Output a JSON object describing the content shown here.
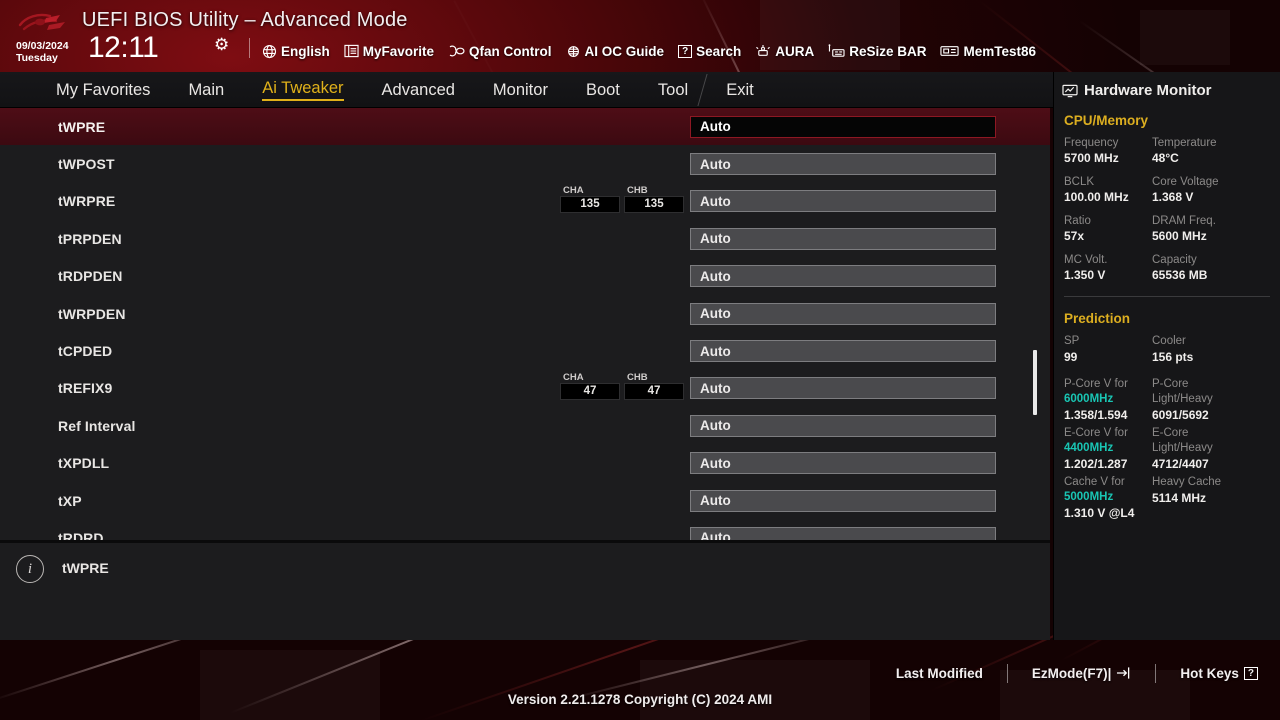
{
  "header": {
    "logo": "rog-logo",
    "title": "UEFI BIOS Utility – Advanced Mode",
    "date": "09/03/2024",
    "weekday": "Tuesday",
    "time": "12:11",
    "gear_icon": "gear-icon",
    "items": [
      {
        "icon": "globe-icon",
        "label": "English"
      },
      {
        "icon": "list-icon",
        "label": "MyFavorite"
      },
      {
        "icon": "fan-icon",
        "label": "Qfan Control"
      },
      {
        "icon": "chip-icon",
        "label": "AI OC Guide"
      },
      {
        "icon": "question-box-icon",
        "label": "Search"
      },
      {
        "icon": "aura-icon",
        "label": "AURA"
      },
      {
        "icon": "resize-bar-icon",
        "label": "ReSize BAR"
      },
      {
        "icon": "memtest-icon",
        "label": "MemTest86"
      }
    ]
  },
  "nav": {
    "tabs": [
      {
        "label": "My Favorites",
        "active": false
      },
      {
        "label": "Main",
        "active": false
      },
      {
        "label": "Ai Tweaker",
        "active": true
      },
      {
        "label": "Advanced",
        "active": false
      },
      {
        "label": "Monitor",
        "active": false
      },
      {
        "label": "Boot",
        "active": false
      },
      {
        "label": "Tool",
        "active": false
      },
      {
        "label": "Exit",
        "active": false
      }
    ],
    "active_color": "#e0b11a"
  },
  "main": {
    "rows": [
      {
        "label": "tWPRE",
        "value": "Auto",
        "selected": true,
        "channels": null
      },
      {
        "label": "tWPOST",
        "value": "Auto",
        "selected": false,
        "channels": null
      },
      {
        "label": "tWRPRE",
        "value": "Auto",
        "selected": false,
        "channels": [
          {
            "name": "CHA",
            "value": "135"
          },
          {
            "name": "CHB",
            "value": "135"
          }
        ]
      },
      {
        "label": "tPRPDEN",
        "value": "Auto",
        "selected": false,
        "channels": null
      },
      {
        "label": "tRDPDEN",
        "value": "Auto",
        "selected": false,
        "channels": null
      },
      {
        "label": "tWRPDEN",
        "value": "Auto",
        "selected": false,
        "channels": null
      },
      {
        "label": "tCPDED",
        "value": "Auto",
        "selected": false,
        "channels": null
      },
      {
        "label": "tREFIX9",
        "value": "Auto",
        "selected": false,
        "channels": [
          {
            "name": "CHA",
            "value": "47"
          },
          {
            "name": "CHB",
            "value": "47"
          }
        ]
      },
      {
        "label": "Ref Interval",
        "value": "Auto",
        "selected": false,
        "channels": null
      },
      {
        "label": "tXPDLL",
        "value": "Auto",
        "selected": false,
        "channels": null
      },
      {
        "label": "tXP",
        "value": "Auto",
        "selected": false,
        "channels": null
      },
      {
        "label": "tRDRD",
        "value": "Auto",
        "selected": false,
        "channels": null
      }
    ],
    "selected_row_color": "#4e0d16",
    "scrollbar": {
      "top_pct": 56,
      "height_pct": 15
    }
  },
  "info_panel": {
    "icon": "info-icon",
    "text": "tWPRE"
  },
  "hardware_monitor": {
    "icon": "monitor-icon",
    "title": "Hardware Monitor",
    "sections": [
      {
        "name": "CPU/Memory",
        "color": "#dcae20",
        "entries": [
          {
            "key": "Frequency",
            "value": "5700 MHz"
          },
          {
            "key": "Temperature",
            "value": "48°C"
          },
          {
            "key": "BCLK",
            "value": "100.00 MHz"
          },
          {
            "key": "Core Voltage",
            "value": "1.368 V"
          },
          {
            "key": "Ratio",
            "value": "57x"
          },
          {
            "key": "DRAM Freq.",
            "value": "5600 MHz"
          },
          {
            "key": "MC Volt.",
            "value": "1.350 V"
          },
          {
            "key": "Capacity",
            "value": "65536 MB"
          }
        ]
      }
    ],
    "prediction": {
      "name": "Prediction",
      "color": "#dcae20",
      "accent_color": "#19c6b4",
      "rows": [
        {
          "left_key": "SP",
          "left_key2": "",
          "left_value": "99",
          "right_key": "Cooler",
          "right_key2": "",
          "right_value": "156 pts"
        },
        {
          "left_key": "P-Core V for",
          "left_key2": "6000MHz",
          "left_value": "1.358/1.594",
          "right_key": "P-Core",
          "right_key2": "Light/Heavy",
          "right_value": "6091/5692"
        },
        {
          "left_key": "E-Core V for",
          "left_key2": "4400MHz",
          "left_value": "1.202/1.287",
          "right_key": "E-Core",
          "right_key2": "Light/Heavy",
          "right_value": "4712/4407"
        },
        {
          "left_key": "Cache V for",
          "left_key2": "5000MHz",
          "left_value": "1.310 V @L4",
          "right_key": "Heavy Cache",
          "right_key2": "",
          "right_value": "5114 MHz"
        }
      ]
    }
  },
  "footer": {
    "last_modified": "Last Modified",
    "ez_mode": "EzMode(F7)|",
    "ez_mode_icon": "arrow-into-bracket-icon",
    "hot_keys": "Hot Keys",
    "hot_keys_icon": "question-box-icon",
    "version": "Version 2.21.1278 Copyright (C) 2024 AMI"
  }
}
